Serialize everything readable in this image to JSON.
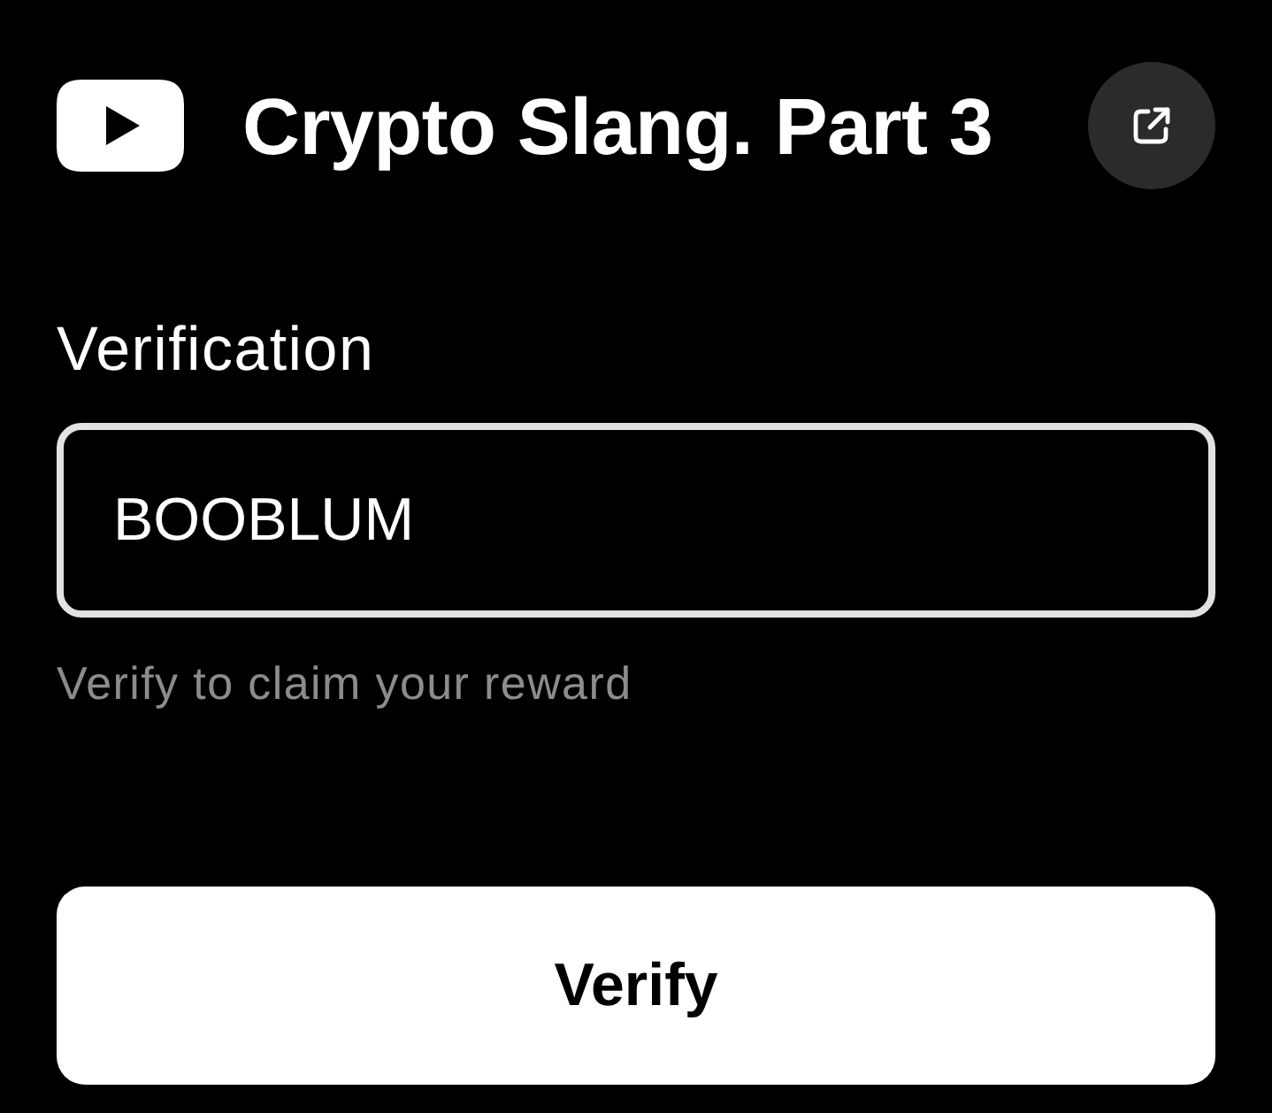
{
  "header": {
    "title": "Crypto Slang. Part 3"
  },
  "verification": {
    "label": "Verification",
    "value": "BOOBLUM",
    "hint": "Verify to claim your reward"
  },
  "button": {
    "label": "Verify"
  }
}
